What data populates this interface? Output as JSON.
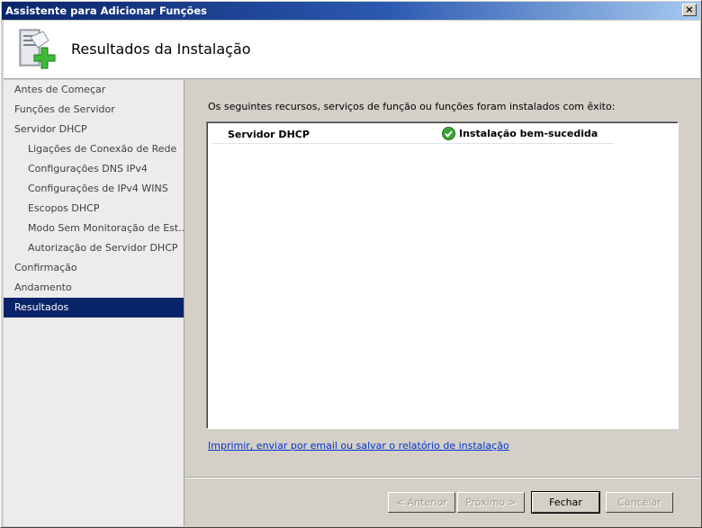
{
  "window": {
    "title": "Assistente para Adicionar Funções",
    "close_label": "×"
  },
  "header": {
    "title": "Resultados da Instalação",
    "icon": "server-add-icon"
  },
  "sidebar": {
    "items": [
      {
        "label": "Antes de Começar",
        "level": 0,
        "active": false
      },
      {
        "label": "Funções de Servidor",
        "level": 0,
        "active": false
      },
      {
        "label": "Servidor DHCP",
        "level": 0,
        "active": false
      },
      {
        "label": "Ligações de Conexão de Rede",
        "level": 1,
        "active": false
      },
      {
        "label": "Configurações DNS IPv4",
        "level": 1,
        "active": false
      },
      {
        "label": "Configurações de IPv4 WINS",
        "level": 1,
        "active": false
      },
      {
        "label": "Escopos DHCP",
        "level": 1,
        "active": false
      },
      {
        "label": "Modo Sem Monitoração de Est…",
        "level": 1,
        "active": false
      },
      {
        "label": "Autorização de Servidor DHCP",
        "level": 1,
        "active": false
      },
      {
        "label": "Confirmação",
        "level": 0,
        "active": false
      },
      {
        "label": "Andamento",
        "level": 0,
        "active": false
      },
      {
        "label": "Resultados",
        "level": 0,
        "active": true
      }
    ]
  },
  "main": {
    "intro": "Os seguintes recursos, serviços de função ou funções foram instalados com êxito:",
    "results": [
      {
        "name": "Servidor DHCP",
        "status": "Instalação bem-sucedida",
        "status_icon": "check-icon"
      }
    ],
    "report_link": "Imprimir, enviar por email ou salvar o relatório de instalação"
  },
  "buttons": {
    "prev": "< Anterior",
    "next": "Próximo >",
    "close": "Fechar",
    "cancel": "Cancelar"
  },
  "colors": {
    "selection": "#0a246a",
    "success": "#3aa335",
    "link": "#0033cc"
  }
}
